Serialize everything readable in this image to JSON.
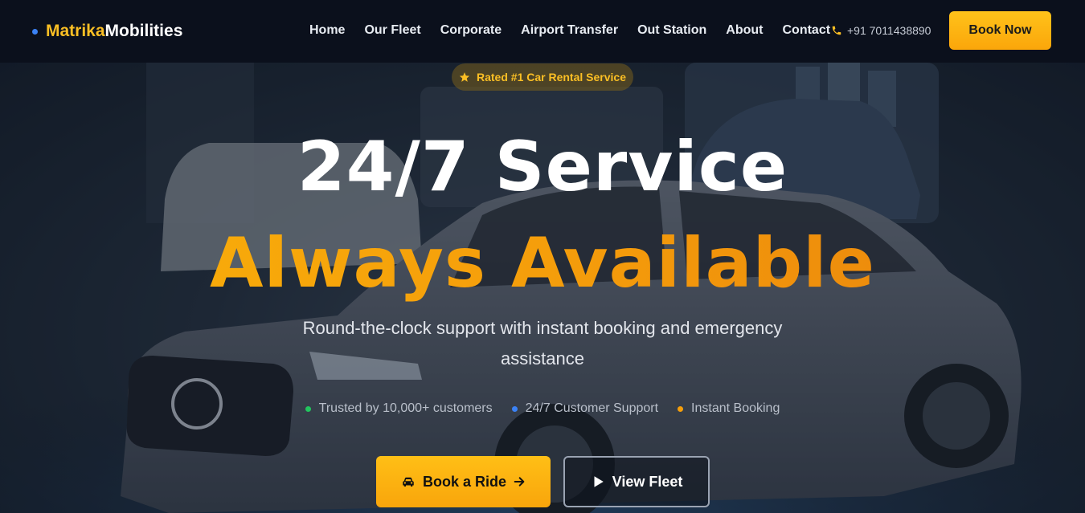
{
  "brand": {
    "part1": "Matrika",
    "part2": "Mobilities"
  },
  "nav": {
    "links": [
      "Home",
      "Our Fleet",
      "Corporate",
      "Airport Transfer",
      "Out Station",
      "About",
      "Contact"
    ],
    "phone": "+91 7011438890",
    "cta": "Book Now"
  },
  "hero": {
    "badge": "Rated #1 Car Rental Service",
    "title_line1": "24/7 Service",
    "title_line2": "Always Available",
    "subtitle": "Round-the-clock support with instant booking and emergency assistance",
    "trust": [
      {
        "text": "Trusted by 10,000+ customers",
        "color": "#22c55e"
      },
      {
        "text": "24/7 Customer Support",
        "color": "#3b82f6"
      },
      {
        "text": "Instant Booking",
        "color": "#f59e0b"
      }
    ],
    "primary_button": "Book a Ride",
    "secondary_button": "View Fleet"
  },
  "colors": {
    "accent": "#fbbf24",
    "nav_bg": "#0b101c"
  },
  "icons": [
    "phone-icon",
    "star-icon",
    "car-icon",
    "arrow-right-icon",
    "play-icon"
  ]
}
